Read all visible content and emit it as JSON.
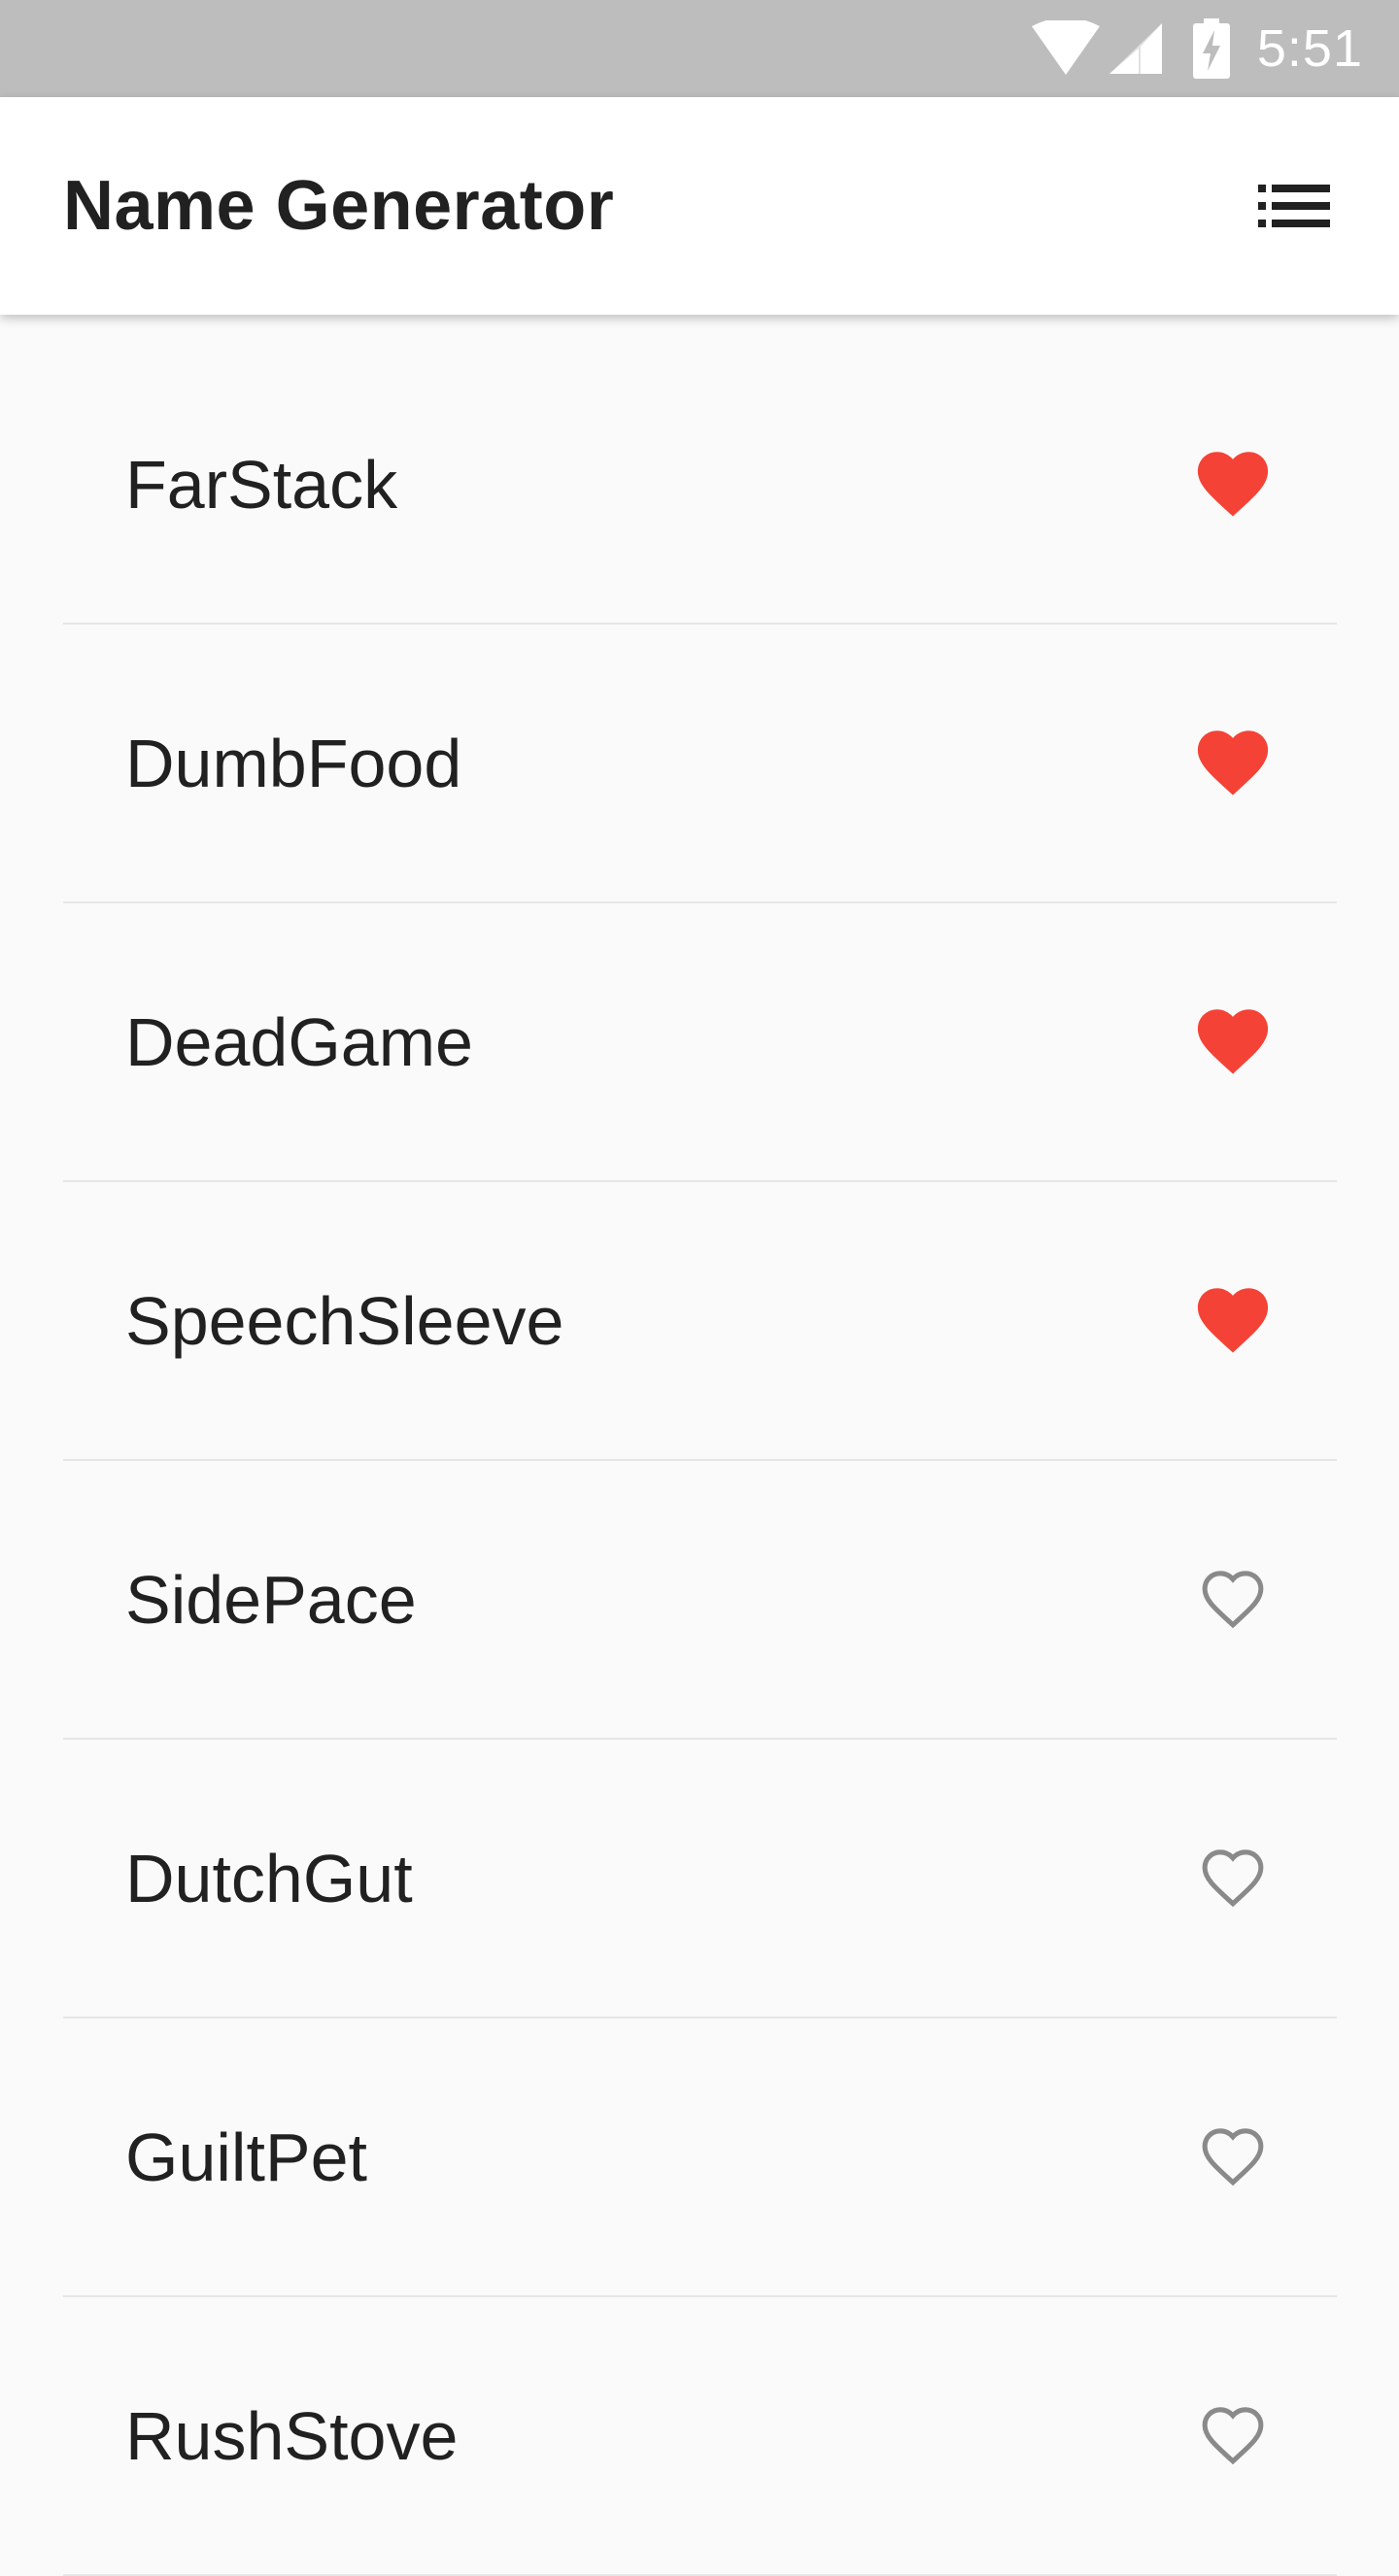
{
  "status_bar": {
    "time": "5:51",
    "icons": [
      "wifi-icon",
      "cellular-signal-icon",
      "battery-charging-icon"
    ]
  },
  "app_bar": {
    "title": "Name Generator",
    "action_icon": "list-icon"
  },
  "colors": {
    "favorite": "#f44336",
    "not_favorite": "#8a8a8a",
    "status_bar": "#bdbdbd",
    "app_bar": "#ffffff",
    "background": "#fafafa",
    "text": "#212121",
    "divider": "#e6e6e6"
  },
  "names": [
    {
      "name": "FarStack",
      "favorited": true
    },
    {
      "name": "DumbFood",
      "favorited": true
    },
    {
      "name": "DeadGame",
      "favorited": true
    },
    {
      "name": "SpeechSleeve",
      "favorited": true
    },
    {
      "name": "SidePace",
      "favorited": false
    },
    {
      "name": "DutchGut",
      "favorited": false
    },
    {
      "name": "GuiltPet",
      "favorited": false
    },
    {
      "name": "RushStove",
      "favorited": false
    }
  ]
}
